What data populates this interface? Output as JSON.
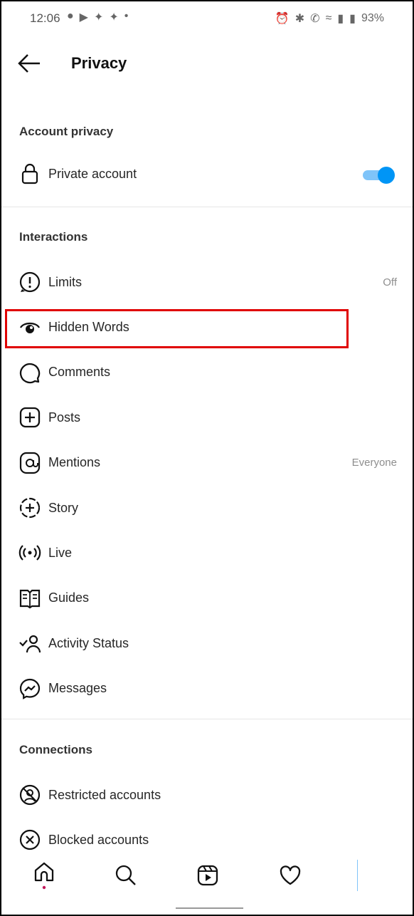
{
  "status_bar": {
    "time": "12:06",
    "battery": "93%"
  },
  "header": {
    "title": "Privacy"
  },
  "account_privacy": {
    "heading": "Account privacy",
    "private_account": {
      "label": "Private account",
      "enabled": true
    }
  },
  "interactions": {
    "heading": "Interactions",
    "items": [
      {
        "label": "Limits",
        "value": "Off",
        "icon": "limits-alert-icon"
      },
      {
        "label": "Hidden Words",
        "value": "",
        "icon": "eye-icon"
      },
      {
        "label": "Comments",
        "value": "",
        "icon": "comment-bubble-icon"
      },
      {
        "label": "Posts",
        "value": "",
        "icon": "plus-square-icon"
      },
      {
        "label": "Mentions",
        "value": "Everyone",
        "icon": "at-icon"
      },
      {
        "label": "Story",
        "value": "",
        "icon": "story-plus-icon"
      },
      {
        "label": "Live",
        "value": "",
        "icon": "live-broadcast-icon"
      },
      {
        "label": "Guides",
        "value": "",
        "icon": "guide-book-icon"
      },
      {
        "label": "Activity Status",
        "value": "",
        "icon": "activity-status-icon"
      },
      {
        "label": "Messages",
        "value": "",
        "icon": "messenger-icon"
      }
    ]
  },
  "connections": {
    "heading": "Connections",
    "items": [
      {
        "label": "Restricted accounts",
        "icon": "restricted-icon"
      },
      {
        "label": "Blocked accounts",
        "icon": "blocked-icon"
      }
    ]
  },
  "colors": {
    "toggle": "#0095f6",
    "highlight": "#e00000",
    "notification_dot": "#c2185b"
  }
}
